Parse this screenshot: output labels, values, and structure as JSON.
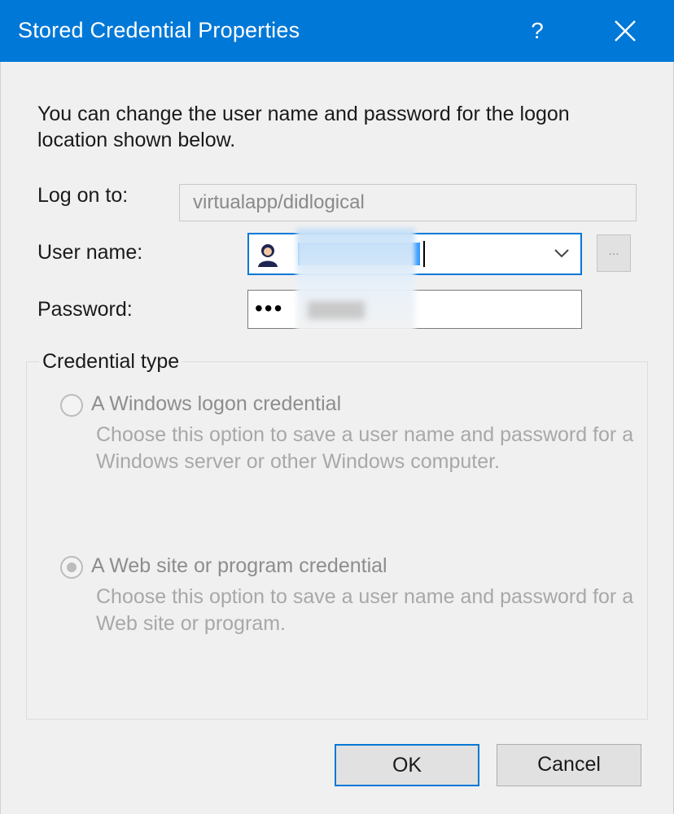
{
  "window": {
    "title": "Stored Credential Properties",
    "help_label": "?",
    "accent_color": "#0078d7"
  },
  "intro_text": "You can change the user name and password for the logon location shown below.",
  "fields": {
    "logon_label": "Log on to:",
    "logon_value": "virtualapp/didlogical",
    "user_label": "User name:",
    "user_value": "",
    "password_label": "Password:",
    "password_value": "•••",
    "browse_label": "..."
  },
  "credential_type": {
    "legend": "Credential type",
    "options": [
      {
        "label": "A Windows logon credential",
        "description": "Choose this option to save a user name and password for a Windows server or other Windows computer.",
        "selected": false
      },
      {
        "label": "A Web site or program credential",
        "description": "Choose this option to save a user name and password for a Web site or program.",
        "selected": true
      }
    ]
  },
  "buttons": {
    "ok": "OK",
    "cancel": "Cancel"
  }
}
